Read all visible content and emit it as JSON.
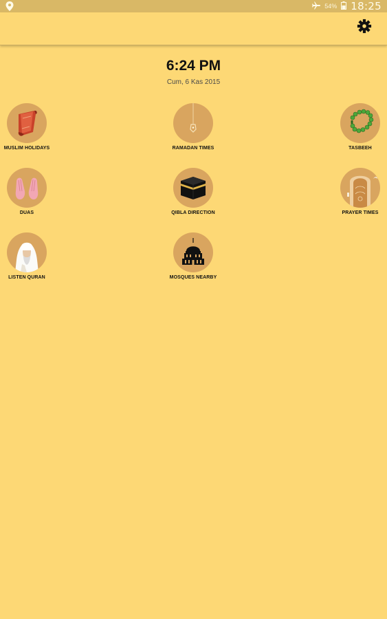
{
  "status_bar": {
    "battery_percent": "54%",
    "time": "18:25",
    "icons": [
      "location-icon",
      "airplane-mode-icon",
      "battery-icon"
    ]
  },
  "toolbar": {
    "settings_icon": "gear-icon"
  },
  "header": {
    "time": "6:24 PM",
    "date": "Cum, 6 Kas 2015"
  },
  "menu": {
    "items": [
      {
        "label": "MUSLIM HOLIDAYS",
        "icon": "prayer-rug-icon"
      },
      {
        "label": "RAMADAN TIMES",
        "icon": "hanging-lantern-icon"
      },
      {
        "label": "TASBEEH",
        "icon": "prayer-beads-icon"
      },
      {
        "label": "DUAS",
        "icon": "praying-hands-icon"
      },
      {
        "label": "QIBLA DIRECTION",
        "icon": "kaaba-icon"
      },
      {
        "label": "PRAYER TIMES",
        "icon": "mosque-door-icon"
      },
      {
        "label": "LISTEN QURAN",
        "icon": "imam-icon"
      },
      {
        "label": "MOSQUES NEARBY",
        "icon": "mosque-dome-icon"
      }
    ]
  },
  "colors": {
    "background": "#fdd875",
    "status_bar": "#d9b866",
    "icon_circle": "#d9a55f"
  }
}
